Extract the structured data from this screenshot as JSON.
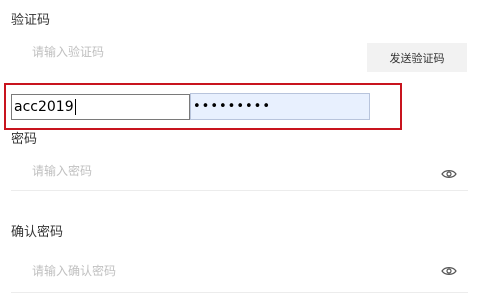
{
  "verification_code": {
    "label": "验证码",
    "placeholder": "请输入验证码",
    "send_button_label": "发送验证码"
  },
  "autofill": {
    "username_value": "acc2019",
    "password_mask": "•••••••••"
  },
  "password": {
    "label": "密码",
    "placeholder": "请输入密码",
    "toggle_icon": "eye-icon"
  },
  "confirm_password": {
    "label": "确认密码",
    "placeholder": "请输入确认密码",
    "toggle_icon": "eye-icon"
  },
  "colors": {
    "highlight_border": "#c8141e",
    "autofill_bg": "#e8f0fe",
    "placeholder": "#c0c0c0"
  }
}
